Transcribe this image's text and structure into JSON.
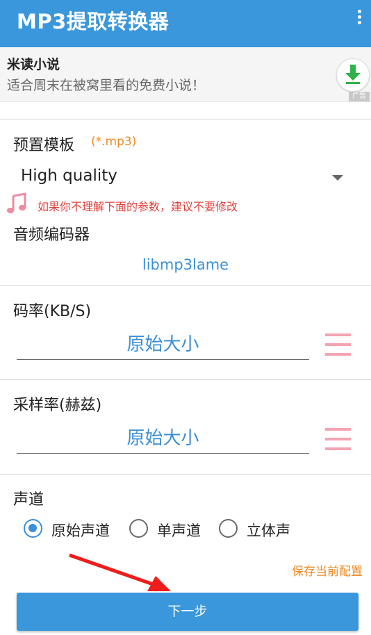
{
  "app": {
    "title": "MP3提取转换器"
  },
  "ad": {
    "title": "米读小说",
    "description": "适合周末在被窝里看的免费小说！",
    "mark": "广告"
  },
  "preset": {
    "label": "预置模板",
    "extension": "(*.mp3)",
    "selected": "High quality"
  },
  "warning": "如果你不理解下面的参数，建议不要修改",
  "codec": {
    "label": "音频编码器",
    "value": "libmp3lame"
  },
  "bitrate": {
    "label": "码率(KB/S)",
    "value": "原始大小"
  },
  "samplerate": {
    "label": "采样率(赫兹)",
    "value": "原始大小"
  },
  "channel": {
    "label": "声道",
    "options": [
      "原始声道",
      "单声道",
      "立体声"
    ],
    "selected_index": 0
  },
  "actions": {
    "save_config": "保存当前配置",
    "next": "下一步"
  },
  "colors": {
    "primary": "#3a97dc",
    "accent_orange": "#ee8a22",
    "warning_red": "#e0403b",
    "menu_pink": "#f4a3b4"
  },
  "icons": {
    "more": "more-vert-icon",
    "download": "download-icon",
    "music_note": "music-note-icon",
    "menu": "menu-icon"
  }
}
